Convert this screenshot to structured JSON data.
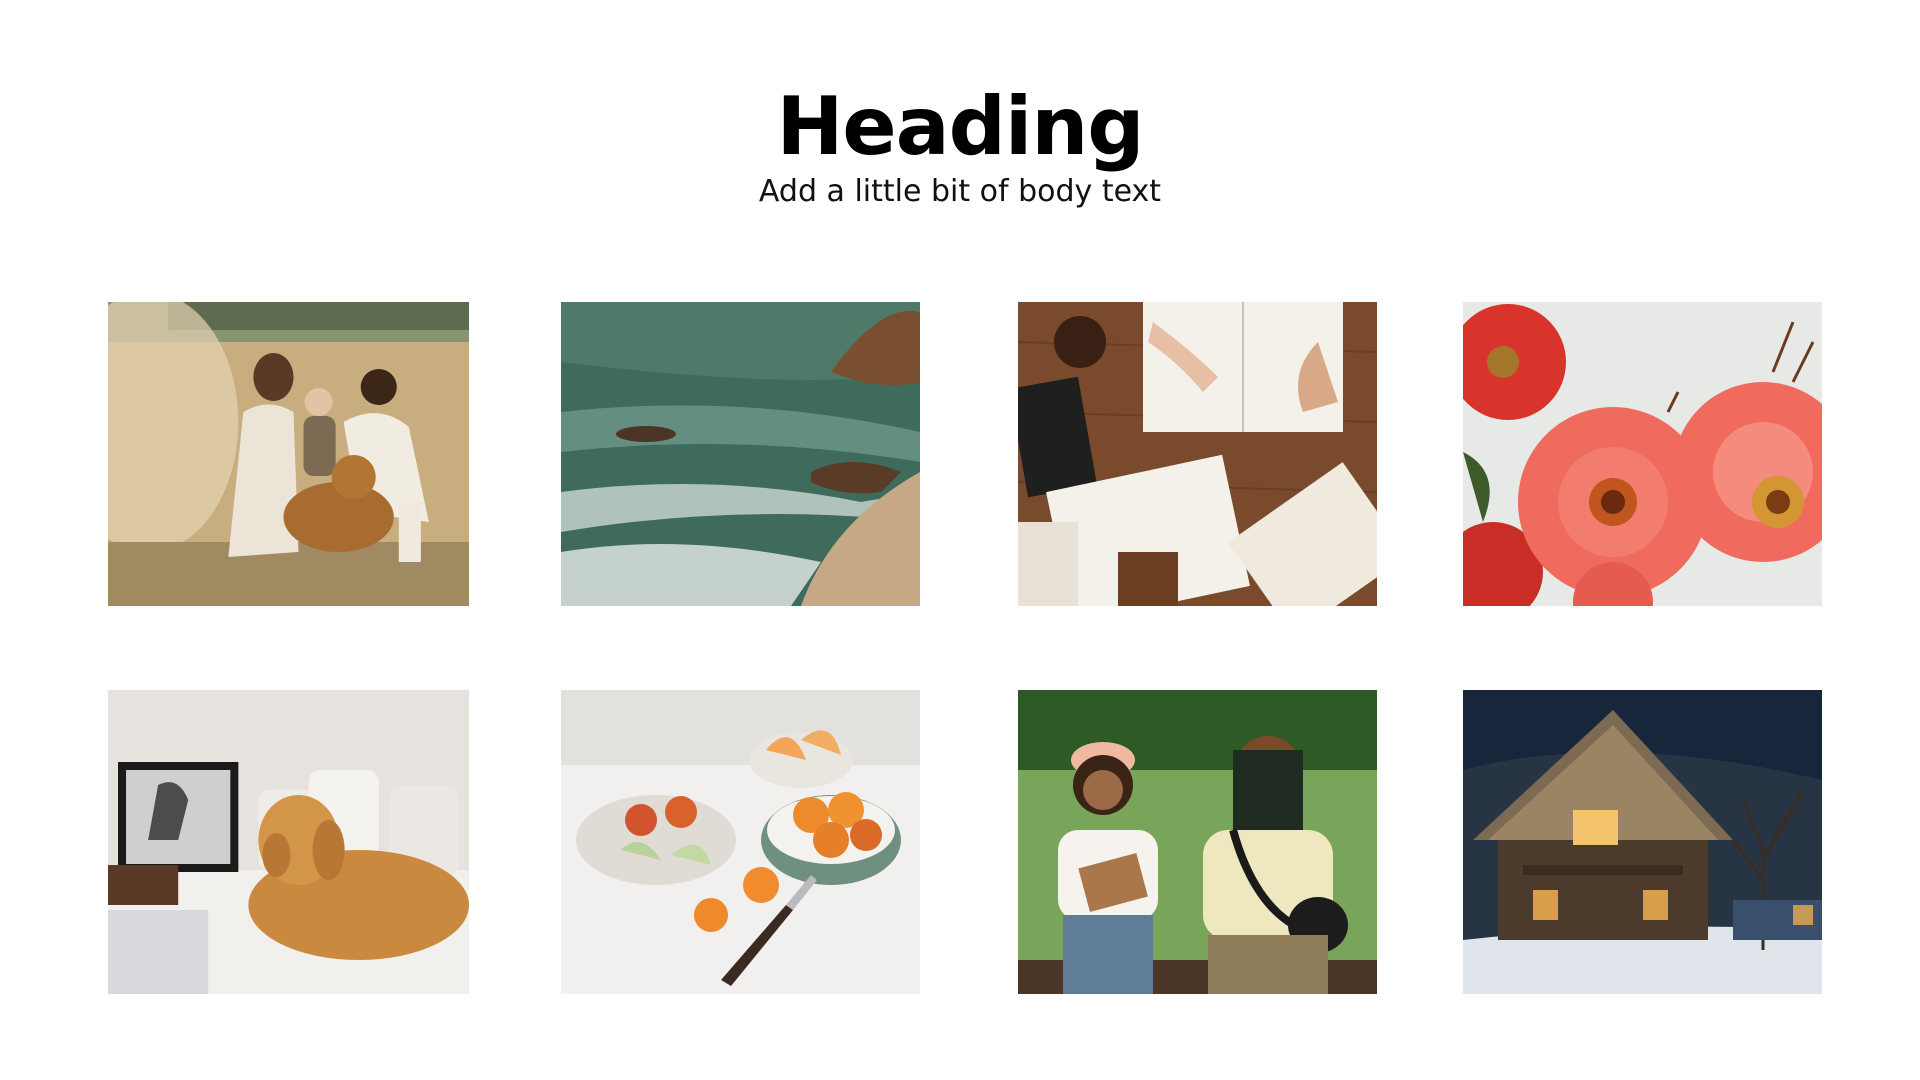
{
  "header": {
    "title": "Heading",
    "subtitle": "Add a little bit of body text"
  },
  "gallery": {
    "items": [
      {
        "icon": "photo-family-with-dog"
      },
      {
        "icon": "photo-ocean-shore"
      },
      {
        "icon": "photo-open-books-on-table"
      },
      {
        "icon": "photo-pink-zinnia-flowers"
      },
      {
        "icon": "photo-golden-retriever-on-bed"
      },
      {
        "icon": "photo-fruit-on-table"
      },
      {
        "icon": "photo-two-friends-reading"
      },
      {
        "icon": "photo-cabin-at-night"
      }
    ]
  },
  "colors": {
    "background": "#ffffff",
    "heading": "#000000"
  }
}
